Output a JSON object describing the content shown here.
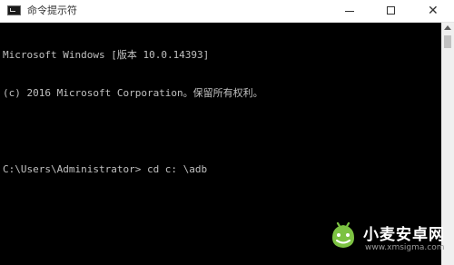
{
  "window": {
    "title": "命令提示符",
    "icon": "cmd-icon"
  },
  "controls": {
    "close_glyph": "✕"
  },
  "console": {
    "lines": [
      "Microsoft Windows [版本 10.0.14393]",
      "(c) 2016 Microsoft Corporation。保留所有权利。",
      "",
      "C:\\Users\\Administrator> cd c: \\adb"
    ]
  },
  "watermark": {
    "title": "小麦安卓网",
    "url": "www.xmsigma.com"
  },
  "colors": {
    "console_bg": "#000000",
    "console_text": "#c0c0c0",
    "titlebar_bg": "#ffffff",
    "watermark_green": "#7cc242"
  }
}
